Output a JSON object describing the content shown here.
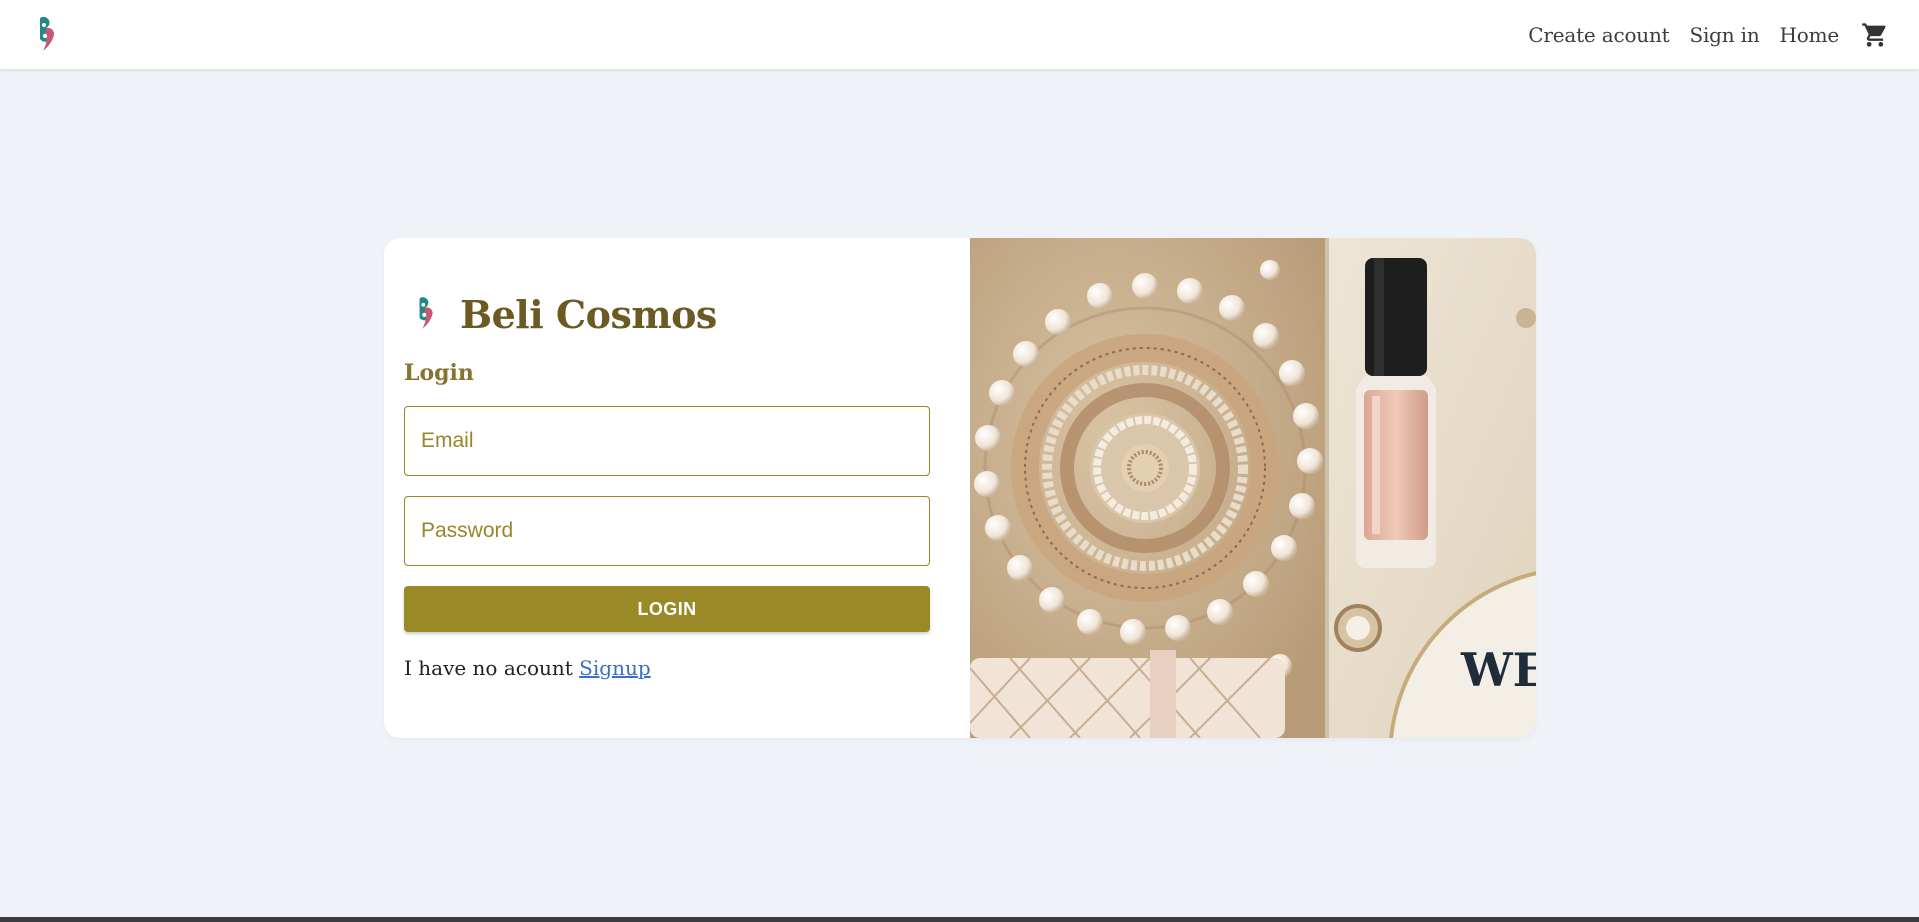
{
  "navbar": {
    "logo": "brand-logo-icon",
    "links": [
      "Create acount",
      "Sign in",
      "Home"
    ],
    "cart_icon": "cart-icon"
  },
  "login_card": {
    "brand_name": "Beli Cosmos",
    "heading": "Login",
    "email_placeholder": "Email",
    "email_value": "",
    "password_placeholder": "Password",
    "password_value": "",
    "login_button_label": "LOGIN",
    "signup_prompt": "I have no acount",
    "signup_link": "Signup"
  },
  "hero_image": {
    "description_icon": "cosmetics-jewelry-image",
    "visible_text": "WE"
  },
  "colors": {
    "accent": "#9a8a27",
    "brand_text": "#6b5a22",
    "page_bg": "#eff3f8",
    "link": "#3a6ec9"
  }
}
